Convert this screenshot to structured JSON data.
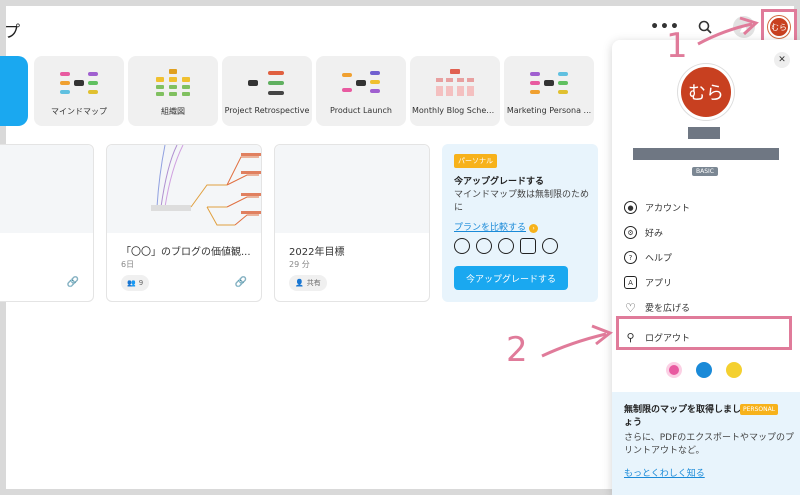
{
  "header": {
    "page_title": "プ",
    "more_icon": "•••"
  },
  "avatar_text": "むら",
  "templates": [
    {
      "label": "マインドマップ"
    },
    {
      "label": "組織図"
    },
    {
      "label": "Project Retrospective"
    },
    {
      "label": "Product Launch"
    },
    {
      "label": "Monthly Blog Sched..."
    },
    {
      "label": "Marketing Persona ..."
    }
  ],
  "cards": [
    {
      "title": "「〇〇」のブログの価値観...",
      "sub": "6日",
      "pill": "9"
    },
    {
      "title": "2022年目標",
      "sub": "29 分",
      "pill": "共有"
    }
  ],
  "upgrade_card": {
    "badge": "パーソナル",
    "heading": "今アップグレードする",
    "description": "マインドマップ数は無制限のために",
    "compare_link": "プランを比較する",
    "button": "今アップグレードする"
  },
  "panel": {
    "plan": "BASIC",
    "menu": [
      {
        "label": "アカウント",
        "icon": "account-icon"
      },
      {
        "label": "好み",
        "icon": "gear-icon"
      },
      {
        "label": "ヘルプ",
        "icon": "help-icon"
      },
      {
        "label": "アプリ",
        "icon": "app-icon"
      },
      {
        "label": "愛を広げる",
        "icon": "heart-icon"
      },
      {
        "label": "ログアウト",
        "icon": "logout-icon"
      }
    ],
    "promo": {
      "heading": "無制限のマップを取得しましょう",
      "badge": "PERSONAL",
      "description": "さらに、PDFのエクスポートやマップのプリントアウトなど。",
      "link": "もっとくわしく知る"
    }
  },
  "annotations": {
    "step1": "1",
    "step2": "2"
  },
  "colors": {
    "accent": "#1aa8f0",
    "highlight": "#e07b9a",
    "avatar": "#c84020",
    "badge": "#f7b21b"
  }
}
